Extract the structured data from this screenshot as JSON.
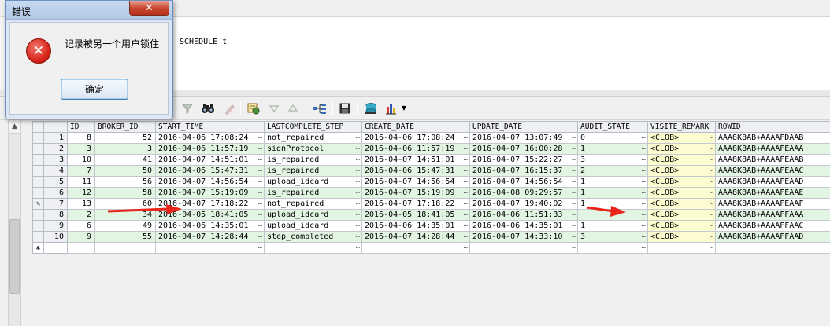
{
  "editor": {
    "sql_fragment": "_SCHEDULE t"
  },
  "dialog": {
    "title": "错误",
    "close_glyph": "✕",
    "icon": "error-x-icon",
    "message": "记录被另一个用户锁住",
    "ok_label": "确定"
  },
  "toolbar": {
    "icons": [
      "binoculars-icon",
      "clear-filter-icon",
      "lookup-icon",
      "sort-desc-icon",
      "sort-asc-icon",
      "query-plan-icon",
      "save-icon",
      "export-icon",
      "chart-icon"
    ]
  },
  "grid": {
    "columns": [
      "ID",
      "BROKER_ID",
      "START_TIME",
      "LASTCOMPLETE_STEP",
      "CREATE_DATE",
      "UPDATE_DATE",
      "AUDIT_STATE",
      "VISITE_REMARK",
      "ROWID"
    ],
    "rows": [
      {
        "rn": "1",
        "id": "8",
        "broker_id": "52",
        "start_time": "2016-04-06 17:08:24",
        "step": "not_repaired",
        "create_date": "2016-04-06 17:08:24",
        "update_date": "2016-04-07 13:07:49",
        "audit_state": "0",
        "remark": "<CLOB>",
        "rowid": "AAA8K8AB+AAAAFDAAB"
      },
      {
        "rn": "2",
        "id": "3",
        "broker_id": "3",
        "start_time": "2016-04-06 11:57:19",
        "step": "signProtocol",
        "create_date": "2016-04-06 11:57:19",
        "update_date": "2016-04-07 16:00:28",
        "audit_state": "1",
        "remark": "<CLOB>",
        "rowid": "AAA8K8AB+AAAAFEAAA"
      },
      {
        "rn": "3",
        "id": "10",
        "broker_id": "41",
        "start_time": "2016-04-07 14:51:01",
        "step": "is_repaired",
        "create_date": "2016-04-07 14:51:01",
        "update_date": "2016-04-07 15:22:27",
        "audit_state": "3",
        "remark": "<CLOB>",
        "rowid": "AAA8K8AB+AAAAFEAAB"
      },
      {
        "rn": "4",
        "id": "7",
        "broker_id": "50",
        "start_time": "2016-04-06 15:47:31",
        "step": "is_repaired",
        "create_date": "2016-04-06 15:47:31",
        "update_date": "2016-04-07 16:15:37",
        "audit_state": "2",
        "remark": "<CLOB>",
        "rowid": "AAA8K8AB+AAAAFEAAC"
      },
      {
        "rn": "5",
        "id": "11",
        "broker_id": "56",
        "start_time": "2016-04-07 14:56:54",
        "step": "upload_idcard",
        "create_date": "2016-04-07 14:56:54",
        "update_date": "2016-04-07 14:56:54",
        "audit_state": "1",
        "remark": "<CLOB>",
        "rowid": "AAA8K8AB+AAAAFEAAD"
      },
      {
        "rn": "6",
        "id": "12",
        "broker_id": "58",
        "start_time": "2016-04-07 15:19:09",
        "step": "is_repaired",
        "create_date": "2016-04-07 15:19:09",
        "update_date": "2016-04-08 09:29:57",
        "audit_state": "1",
        "remark": "<CLOB>",
        "rowid": "AAA8K8AB+AAAAFEAAE"
      },
      {
        "rn": "7",
        "id": "13",
        "broker_id": "60",
        "start_time": "2016-04-07 17:18:22",
        "step": "not_repaired",
        "create_date": "2016-04-07 17:18:22",
        "update_date": "2016-04-07 19:40:02",
        "audit_state": "1",
        "remark": "<CLOB>",
        "rowid": "AAA8K8AB+AAAAFEAAF"
      },
      {
        "rn": "8",
        "id": "2",
        "broker_id": "34",
        "start_time": "2016-04-05 18:41:05",
        "step": "upload_idcard",
        "create_date": "2016-04-05 18:41:05",
        "update_date": "2016-04-06 11:51:33",
        "audit_state": "",
        "remark": "<CLOB>",
        "rowid": "AAA8K8AB+AAAAFFAAA"
      },
      {
        "rn": "9",
        "id": "6",
        "broker_id": "49",
        "start_time": "2016-04-06 14:35:01",
        "step": "upload_idcard",
        "create_date": "2016-04-06 14:35:01",
        "update_date": "2016-04-06 14:35:01",
        "audit_state": "1",
        "remark": "<CLOB>",
        "rowid": "AAA8K8AB+AAAAFFAAC"
      },
      {
        "rn": "10",
        "id": "9",
        "broker_id": "55",
        "start_time": "2016-04-07 14:28:44",
        "step": "step_completed",
        "create_date": "2016-04-07 14:28:44",
        "update_date": "2016-04-07 14:33:10",
        "audit_state": "3",
        "remark": "<CLOB>",
        "rowid": "AAA8K8AB+AAAAFFAAD"
      }
    ],
    "editing_row_index": 6,
    "edit_indicator_glyph": "✎",
    "new_row_indicator": "✱"
  },
  "colors": {
    "even_row": "#e2f5e2",
    "clob_cell": "#fdfbd0",
    "arrow_red": "#e8261c"
  }
}
